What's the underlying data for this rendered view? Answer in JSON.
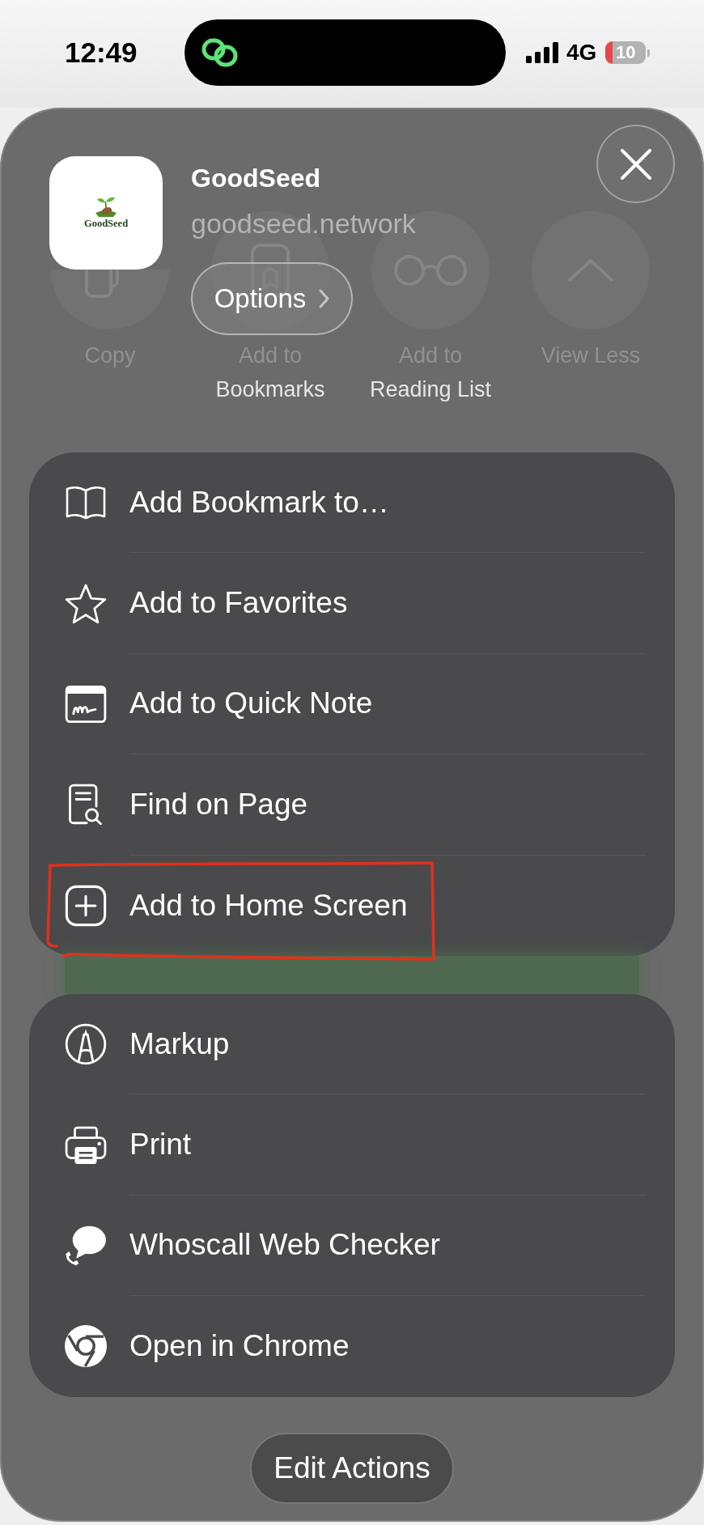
{
  "status_bar": {
    "time": "12:49",
    "network": "4G",
    "battery": "10",
    "battery_low": true
  },
  "share_sheet": {
    "background_actions": [
      {
        "kind": "copy",
        "lines": [
          "Copy"
        ]
      },
      {
        "kind": "bookmarks",
        "lines": [
          "Add to",
          "Bookmarks"
        ]
      },
      {
        "kind": "glasses",
        "lines": [
          "Add to",
          "Reading List"
        ]
      },
      {
        "kind": "chevron",
        "lines": [
          "View Less"
        ]
      }
    ],
    "header": {
      "logo_text": "GoodSeed",
      "title": "GoodSeed",
      "url": "goodseed.network",
      "options_button": "Options"
    },
    "action_groups": [
      {
        "items": [
          {
            "kind": "book",
            "label": "Add Bookmark to…",
            "highlighted": false
          },
          {
            "kind": "star",
            "label": "Add to Favorites",
            "highlighted": false
          },
          {
            "kind": "note",
            "label": "Add to Quick Note",
            "highlighted": false
          },
          {
            "kind": "find",
            "label": "Find on Page",
            "highlighted": false
          },
          {
            "kind": "add",
            "label": "Add to Home Screen",
            "highlighted": true
          }
        ]
      },
      {
        "items": [
          {
            "kind": "markup",
            "label": "Markup",
            "highlighted": false
          },
          {
            "kind": "print",
            "label": "Print",
            "highlighted": false
          },
          {
            "kind": "chat",
            "label": "Whoscall Web Checker",
            "highlighted": false
          },
          {
            "kind": "chrome",
            "label": "Open in Chrome",
            "highlighted": false
          }
        ]
      }
    ],
    "edit_button": "Edit Actions"
  }
}
